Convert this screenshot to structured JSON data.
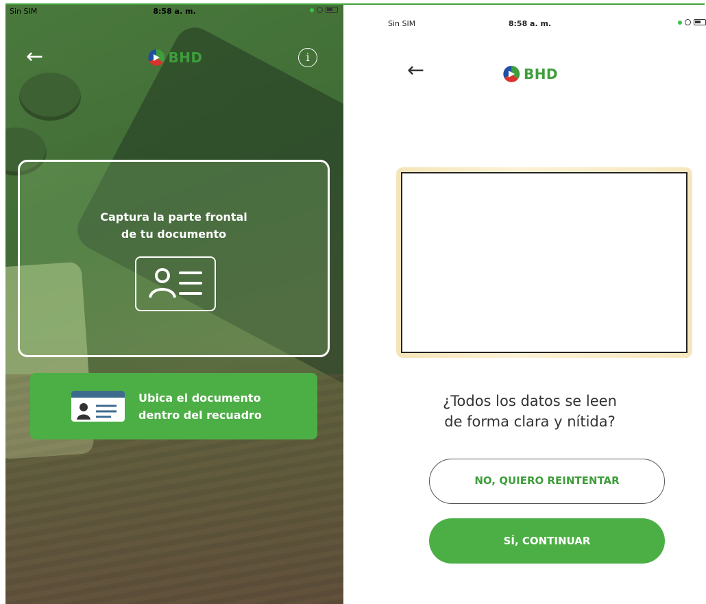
{
  "left_screen": {
    "status_bar": {
      "carrier": "Sin SIM",
      "time": "8:58 a. m."
    },
    "header": {
      "logo_text": "BHD"
    },
    "frame_prompt": {
      "line1": "Captura la parte frontal",
      "line2": "de tu documento"
    },
    "hint": {
      "line1": "Ubica el documento",
      "line2": "dentro del recuadro"
    }
  },
  "right_screen": {
    "status_bar": {
      "carrier": "Sin SIM",
      "time": "8:58 a. m."
    },
    "header": {
      "logo_text": "BHD"
    },
    "question": {
      "line1": "¿Todos los datos se leen",
      "line2": "de forma clara y nítida?"
    },
    "retry_button": "NO, QUIERO REINTENTAR",
    "continue_button": "SÍ, CONTINUAR"
  },
  "colors": {
    "brand_green": "#4caf45",
    "logo_green": "#3e9e3b",
    "logo_blue": "#1f4fa3",
    "logo_red": "#d8332c"
  }
}
